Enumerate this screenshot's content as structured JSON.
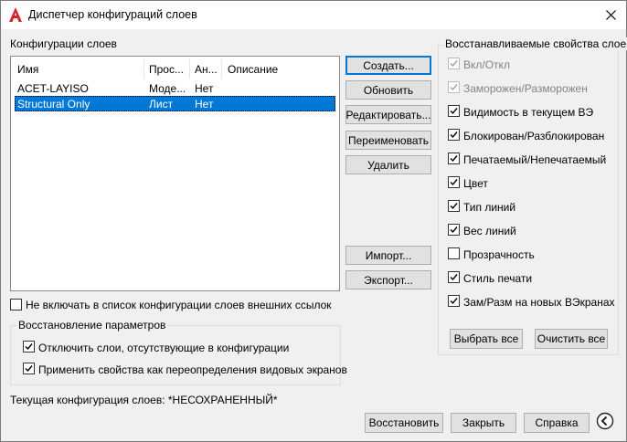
{
  "window": {
    "title": "Диспетчер конфигураций слоев",
    "brand_color": "#d8232a"
  },
  "configs": {
    "label": "Конфигурации слоев",
    "columns": [
      "Имя",
      "Прос...",
      "Ан...",
      "Описание"
    ],
    "rows": [
      {
        "name": "ACET-LAYISO",
        "view": "Моде...",
        "annot": "Нет",
        "desc": ""
      },
      {
        "name": "Structural Only",
        "view": "Лист",
        "annot": "Нет",
        "desc": ""
      }
    ],
    "selected_index": 1
  },
  "buttons": {
    "create": "Создать...",
    "update": "Обновить",
    "edit": "Редактировать...",
    "rename": "Переименовать",
    "delete": "Удалить",
    "import": "Импорт...",
    "export": "Экспорт..."
  },
  "exclude_xref": {
    "label": "Не включать в список конфигурации слоев внешних ссылок",
    "checked": false
  },
  "restore": {
    "title": "Восстановление параметров",
    "turn_off_label": "Отключить слои, отсутствующие в конфигурации",
    "apply_label": "Применить свойства как переопределения видовых экранов"
  },
  "current": {
    "label": "Текущая конфигурация слоев: *НЕСОХРАНЕННЫЙ*"
  },
  "props": {
    "title": "Восстанавливаемые свойства слоев",
    "items": [
      {
        "label": "Вкл/Откл",
        "checked": true,
        "disabled": true
      },
      {
        "label": "Заморожен/Разморожен",
        "checked": true,
        "disabled": true
      },
      {
        "label": "Видимость в текущем ВЭ",
        "checked": true,
        "disabled": false
      },
      {
        "label": "Блокирован/Разблокирован",
        "checked": true,
        "disabled": false
      },
      {
        "label": "Печатаемый/Непечатаемый",
        "checked": true,
        "disabled": false
      },
      {
        "label": "Цвет",
        "checked": true,
        "disabled": false
      },
      {
        "label": "Тип линий",
        "checked": true,
        "disabled": false
      },
      {
        "label": "Вес линий",
        "checked": true,
        "disabled": false
      },
      {
        "label": "Прозрачность",
        "checked": false,
        "disabled": false
      },
      {
        "label": "Стиль печати",
        "checked": true,
        "disabled": false
      },
      {
        "label": "Зам/Разм на новых ВЭкранах",
        "checked": true,
        "disabled": false
      }
    ],
    "select_all": "Выбрать все",
    "clear_all": "Очистить все"
  },
  "footer": {
    "restore": "Восстановить",
    "close": "Закрыть",
    "help": "Справка"
  }
}
